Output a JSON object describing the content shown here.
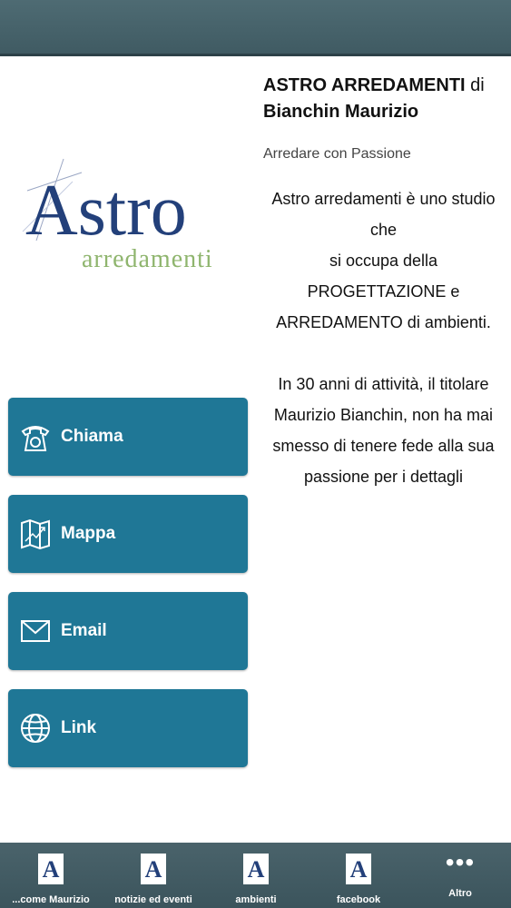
{
  "header": {},
  "logo": {
    "brand": "Astro",
    "tagline": "arredamenti"
  },
  "content": {
    "title_bold": "ASTRO ARREDAMENTI",
    "title_rest": "di",
    "title_line2": "Bianchin Maurizio",
    "subtitle": "Arredare con Passione",
    "description": "Astro arredamenti è uno studio che\nsi occupa  della\nPROGETTAZIONE e\nARREDAMENTO di ambienti.\n\nIn 30 anni di attività, il titolare\nMaurizio Bianchin, non ha mai\nsmesso di tenere fede alla sua\npassione per i dettagli"
  },
  "actions": [
    {
      "label": "Chiama",
      "icon": "phone-icon"
    },
    {
      "label": "Mappa",
      "icon": "map-icon"
    },
    {
      "label": "Email",
      "icon": "envelope-icon"
    },
    {
      "label": "Link",
      "icon": "globe-icon"
    }
  ],
  "tabbar": {
    "tabs": [
      {
        "label": "...come Maurizio",
        "icon": "astro-tab-icon"
      },
      {
        "label": "notizie ed eventi",
        "icon": "astro-tab-icon"
      },
      {
        "label": "ambienti",
        "icon": "astro-tab-icon"
      },
      {
        "label": "facebook",
        "icon": "astro-tab-icon"
      },
      {
        "label": "Altro",
        "icon": "more-dots-icon",
        "glyph": "•••"
      }
    ]
  },
  "colors": {
    "button": "#1f7796",
    "bars": "#4a636b",
    "logo_blue": "#23407a",
    "logo_green": "#8fb56e"
  }
}
